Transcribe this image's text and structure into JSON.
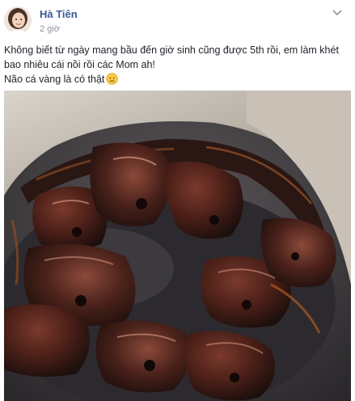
{
  "post": {
    "author": "Hà Tiên",
    "timestamp": "2 giờ",
    "lines": [
      "Không biết từ ngày mang bầu đến giờ sinh cũng được 5th rồi, em làm khét bao nhiêu cái nồi rồi các Mom ah!",
      "Não cá vàng là có thật"
    ],
    "emoji_icon": "sad-face-emoji-icon",
    "photo_icon": "burnt-pot-photo"
  },
  "colors": {
    "author_link": "#385898",
    "body_text": "#1d2129",
    "meta_text": "#8d949e"
  }
}
